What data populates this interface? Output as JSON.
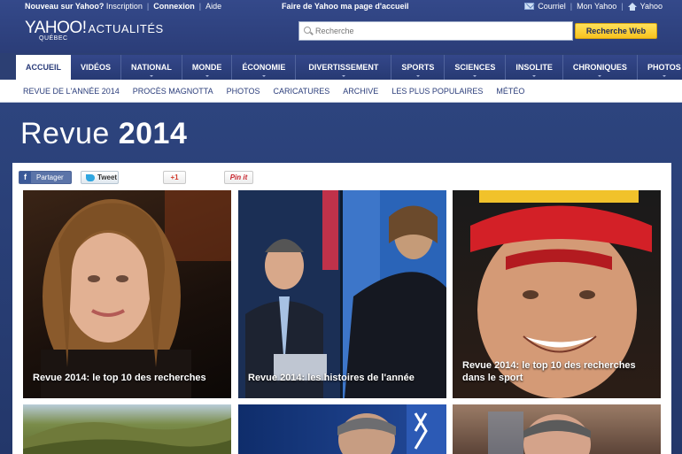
{
  "utility": {
    "new_user": "Nouveau sur Yahoo?",
    "signup": "Inscription",
    "signin": "Connexion",
    "help": "Aide",
    "homepage": "Faire de Yahoo ma page d'accueil",
    "mail": "Courriel",
    "my_yahoo": "Mon Yahoo",
    "yahoo": "Yahoo"
  },
  "logo": {
    "brand": "YAHOO!",
    "section": "ACTUALITÉS",
    "region": "QUÉBEC"
  },
  "search": {
    "placeholder": "Recherche",
    "button": "Recherche Web"
  },
  "nav": {
    "items": [
      {
        "label": "ACCUEIL"
      },
      {
        "label": "VIDÉOS"
      },
      {
        "label": "NATIONAL"
      },
      {
        "label": "MONDE"
      },
      {
        "label": "ÉCONOMIE"
      },
      {
        "label": "DIVERTISSEMENT"
      },
      {
        "label": "SPORTS"
      },
      {
        "label": "SCIENCES"
      },
      {
        "label": "INSOLITE"
      },
      {
        "label": "CHRONIQUES"
      },
      {
        "label": "PHOTOS"
      }
    ]
  },
  "subnav": {
    "items": [
      {
        "label": "REVUE DE L'ANNÉE 2014"
      },
      {
        "label": "PROCÈS MAGNOTTA"
      },
      {
        "label": "PHOTOS"
      },
      {
        "label": "CARICATURES"
      },
      {
        "label": "ARCHIVE"
      },
      {
        "label": "LES PLUS POPULAIRES"
      },
      {
        "label": "MÉTÉO"
      }
    ]
  },
  "hero": {
    "title_light": "Revue ",
    "title_bold": "2014"
  },
  "share": {
    "facebook": "Partager",
    "twitter": "Tweet",
    "gplus": "+1",
    "pinterest": "Pin it"
  },
  "cards": [
    {
      "caption": "Revue 2014: le top 10 des recherches"
    },
    {
      "caption": "Revue 2014: les histoires de l'année"
    },
    {
      "caption": "Revue 2014: le top 10 des recherches dans le sport"
    }
  ]
}
